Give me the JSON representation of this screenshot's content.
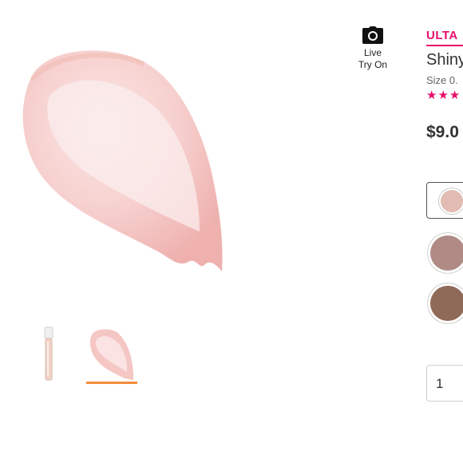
{
  "try_on": {
    "line1": "Live",
    "line2": "Try On",
    "icon": "camera-icon"
  },
  "product": {
    "brand": "ULTA",
    "name": "Shiny",
    "size": "Size 0.",
    "rating_stars": "★★★",
    "price": "$9.0"
  },
  "images": {
    "main": "lip-gloss-swatch",
    "thumbnails": [
      "lip-gloss-tube",
      "lip-gloss-swatch"
    ],
    "active_thumbnail_index": 1
  },
  "shades": {
    "selected_index": 0,
    "colors": [
      "#e2bcb2",
      "#b08b86",
      "#8f6a58"
    ]
  },
  "quantity": {
    "value": "1"
  },
  "colors": {
    "brand_accent": "#e80e6b",
    "thumb_indicator": "#f28c3a"
  }
}
